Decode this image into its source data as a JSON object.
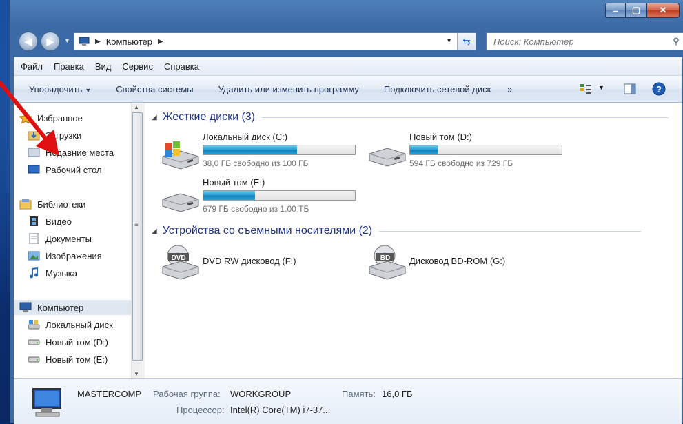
{
  "window": {
    "caption_buttons": [
      "minimize",
      "maximize",
      "close"
    ]
  },
  "address": {
    "crumb": "Компьютер",
    "search_placeholder": "Поиск: Компьютер"
  },
  "menu": [
    "Файл",
    "Правка",
    "Вид",
    "Сервис",
    "Справка"
  ],
  "toolbar": {
    "organize": "Упорядочить",
    "system_props": "Свойства системы",
    "uninstall": "Удалить или изменить программу",
    "map_drive": "Подключить сетевой диск",
    "more": "»"
  },
  "nav": {
    "favorites": "Избранное",
    "downloads": "Загрузки",
    "recent": "Недавние места",
    "desktop": "Рабочий стол",
    "libraries": "Библиотеки",
    "video": "Видео",
    "documents": "Документы",
    "images": "Изображения",
    "music": "Музыка",
    "computer": "Компьютер",
    "local_disk": "Локальный диск",
    "vol_d": "Новый том (D:)",
    "vol_e": "Новый том (E:)"
  },
  "groups": {
    "hard_disks": "Жесткие диски (3)",
    "removable": "Устройства со съемными носителями (2)"
  },
  "drives": [
    {
      "name": "Локальный диск (C:)",
      "free": "38,0 ГБ свободно из 100 ГБ",
      "used_fraction": 0.62
    },
    {
      "name": "Новый том (D:)",
      "free": "594 ГБ свободно из 729 ГБ",
      "used_fraction": 0.185
    },
    {
      "name": "Новый том (E:)",
      "free": "679 ГБ свободно из 1,00 ТБ",
      "used_fraction": 0.34
    }
  ],
  "devices": [
    {
      "name": "DVD RW дисковод (F:)",
      "badge": "DVD"
    },
    {
      "name": "Дисковод BD-ROM (G:)",
      "badge": "BD"
    }
  ],
  "details": {
    "computer_name": "MASTERCOMP",
    "workgroup_label": "Рабочая группа:",
    "workgroup": "WORKGROUP",
    "memory_label": "Память:",
    "memory": "16,0 ГБ",
    "cpu_label": "Процессор:",
    "cpu": "Intel(R) Core(TM) i7-37..."
  },
  "colors": {
    "accent": "#1e3287",
    "progress": "#26a0da",
    "annotation_arrow": "#e01010"
  }
}
